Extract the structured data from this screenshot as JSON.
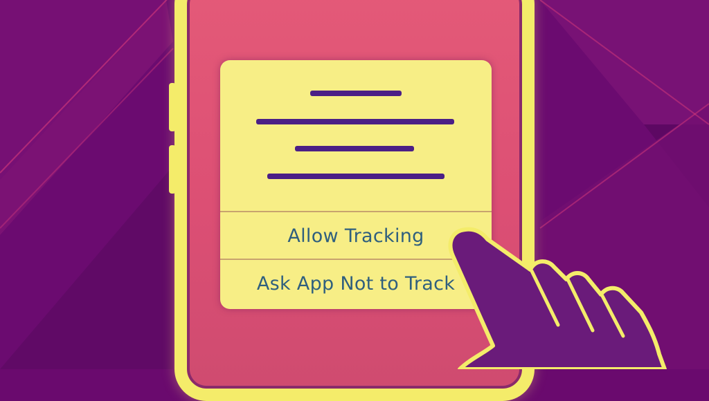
{
  "dialog": {
    "actions": [
      {
        "label": "Allow Tracking"
      },
      {
        "label": "Ask App Not to Track"
      }
    ]
  },
  "colors": {
    "background": "#6a0a6e",
    "frame": "#f4ec6a",
    "screen": "#e45a78",
    "dialog": "#f7ee86",
    "text_lines": "#4b1f86",
    "action_text": "#2f5f7e"
  },
  "icons": {
    "pointer": "pointing-hand-icon"
  }
}
